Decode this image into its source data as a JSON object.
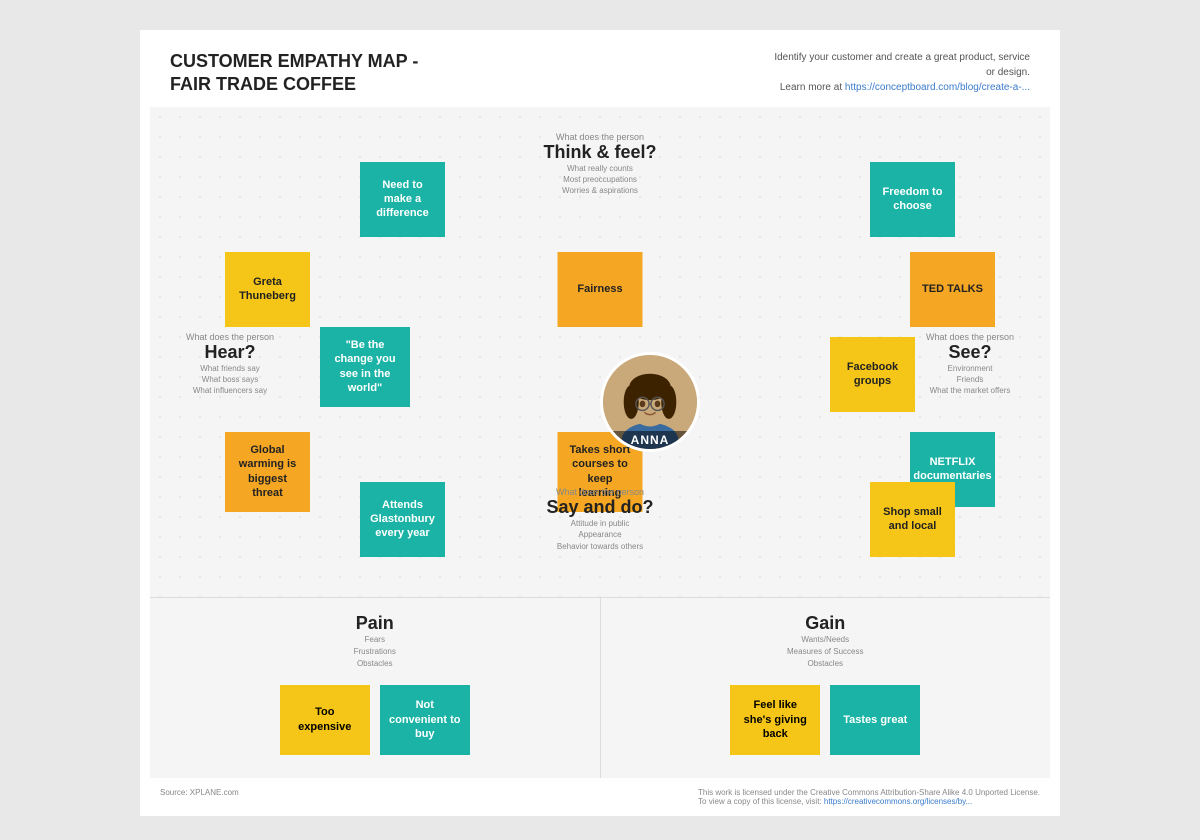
{
  "header": {
    "title_line1": "CUSTOMER EMPATHY MAP -",
    "title_line2": "FAIR TRADE COFFEE",
    "subtitle": "Identify your customer and create a great product, service or design.",
    "learn_more_text": "Learn more at ",
    "learn_more_link": "https://conceptboard.com/blog/create-a-..."
  },
  "sections": {
    "think_feel": {
      "header": "What does the person",
      "title": "Think & feel?",
      "sub": "What really counts\nMost preoccupations\nWorries & aspirations"
    },
    "hear": {
      "header": "What does the person",
      "title": "Hear?",
      "sub": "What friends say\nWhat boss says\nWhat influencers say"
    },
    "see": {
      "header": "What does the person",
      "title": "See?",
      "sub": "Environment\nFriends\nWhat the market offers"
    },
    "say_do": {
      "header": "What does the person",
      "title": "Say and do?",
      "sub": "Attitude in public\nAppearance\nBehavior towards others"
    }
  },
  "notes": {
    "need_to_make": "Need to make a difference",
    "freedom_choose": "Freedom to choose",
    "greta": "Greta Thuneberg",
    "fairness": "Fairness",
    "ted_talks": "TED TALKS",
    "be_change": "\"Be the change you see in the world\"",
    "facebook_groups": "Facebook groups",
    "global_warming": "Global warming is biggest threat",
    "takes_short": "Takes short courses to keep learning",
    "netflix": "NETFLIX documentaries",
    "attends_glastonbury": "Attends Glastonbury every year",
    "shop_small": "Shop small and local"
  },
  "avatar": {
    "name": "ANNA"
  },
  "pain": {
    "title": "Pain",
    "sub": "Fears\nFrustrations\nObstacles",
    "notes": {
      "too_expensive": "Too expensive",
      "not_convenient": "Not convenient to buy"
    }
  },
  "gain": {
    "title": "Gain",
    "sub": "Wants/Needs\nMeasures of Success\nObstacles",
    "notes": {
      "feel_giving": "Feel like she's giving back",
      "tastes_great": "Tastes great"
    }
  },
  "footer": {
    "source": "Source: XPLANE.com",
    "license_text": "This work is licensed under the Creative Commons Attribution-Share Alike 4.0 Unported License.",
    "license_visit": "To view a copy of this license, visit: ",
    "license_link": "https://creativecommons.org/licenses/by..."
  }
}
